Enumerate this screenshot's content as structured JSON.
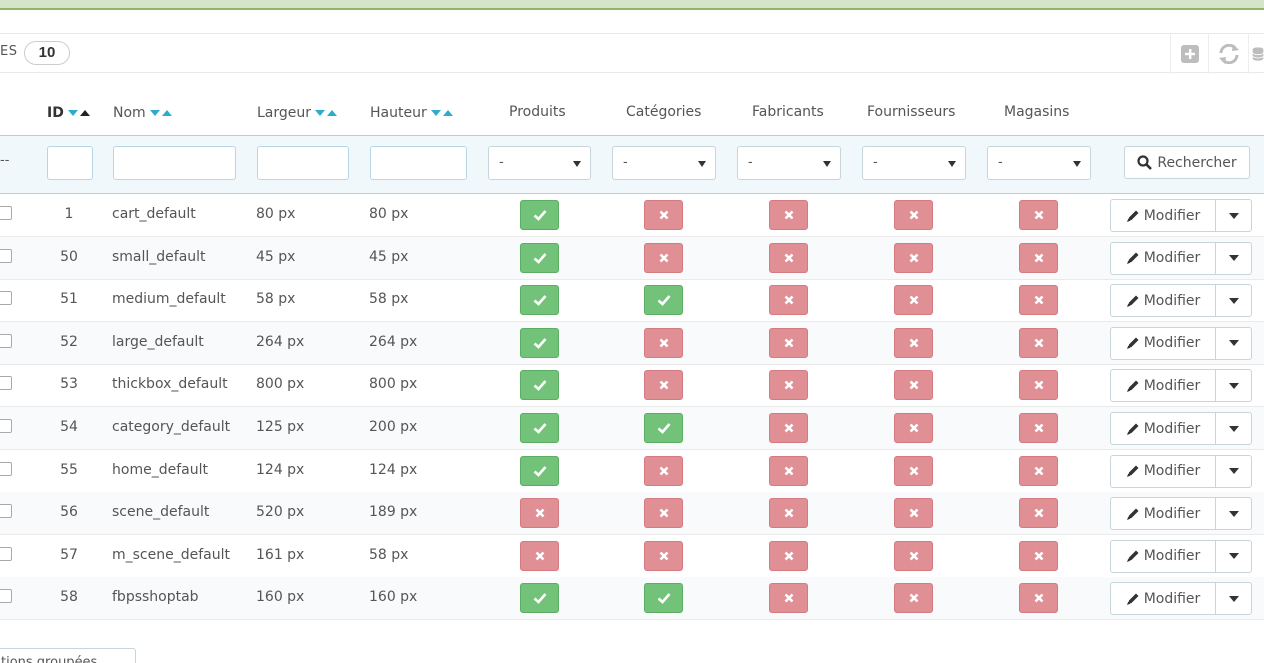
{
  "panel": {
    "title_fragment": "ES",
    "count": "10",
    "tools": [
      "add-icon",
      "refresh-icon",
      "sql-icon"
    ]
  },
  "table": {
    "headers": {
      "id": "ID",
      "name": "Nom",
      "width": "Largeur",
      "height": "Hauteur",
      "products": "Produits",
      "categories": "Catégories",
      "manufacturers": "Fabricants",
      "suppliers": "Fournisseurs",
      "stores": "Magasins"
    },
    "filters": {
      "dash": "--",
      "select_value": "-",
      "search_label": "Rechercher"
    },
    "rows": [
      {
        "id": "1",
        "name": "cart_default",
        "width": "80 px",
        "height": "80 px",
        "products": true,
        "categories": false,
        "manufacturers": false,
        "suppliers": false,
        "stores": false
      },
      {
        "id": "50",
        "name": "small_default",
        "width": "45 px",
        "height": "45 px",
        "products": true,
        "categories": false,
        "manufacturers": false,
        "suppliers": false,
        "stores": false
      },
      {
        "id": "51",
        "name": "medium_default",
        "width": "58 px",
        "height": "58 px",
        "products": true,
        "categories": true,
        "manufacturers": false,
        "suppliers": false,
        "stores": false
      },
      {
        "id": "52",
        "name": "large_default",
        "width": "264 px",
        "height": "264 px",
        "products": true,
        "categories": false,
        "manufacturers": false,
        "suppliers": false,
        "stores": false
      },
      {
        "id": "53",
        "name": "thickbox_default",
        "width": "800 px",
        "height": "800 px",
        "products": true,
        "categories": false,
        "manufacturers": false,
        "suppliers": false,
        "stores": false
      },
      {
        "id": "54",
        "name": "category_default",
        "width": "125 px",
        "height": "200 px",
        "products": true,
        "categories": true,
        "manufacturers": false,
        "suppliers": false,
        "stores": false
      },
      {
        "id": "55",
        "name": "home_default",
        "width": "124 px",
        "height": "124 px",
        "products": true,
        "categories": false,
        "manufacturers": false,
        "suppliers": false,
        "stores": false
      },
      {
        "id": "56",
        "name": "scene_default",
        "width": "520 px",
        "height": "189 px",
        "products": false,
        "categories": false,
        "manufacturers": false,
        "suppliers": false,
        "stores": false
      },
      {
        "id": "57",
        "name": "m_scene_default",
        "width": "161 px",
        "height": "58 px",
        "products": false,
        "categories": false,
        "manufacturers": false,
        "suppliers": false,
        "stores": false
      },
      {
        "id": "58",
        "name": "fbpsshoptab",
        "width": "160 px",
        "height": "160 px",
        "products": true,
        "categories": true,
        "manufacturers": false,
        "suppliers": false,
        "stores": false
      }
    ],
    "row_action": "Modifier"
  },
  "bulk_actions_label": "tions groupées",
  "colors": {
    "yes": "#72c279",
    "no": "#e08f95",
    "accent": "#2eacce",
    "filter_bg": "#f1f8fc"
  }
}
